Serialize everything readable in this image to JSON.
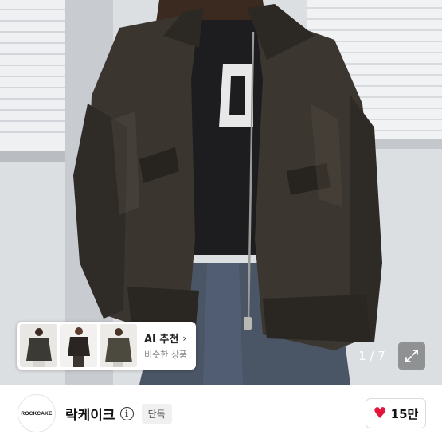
{
  "hero": {
    "image_description_icon": "product-photo"
  },
  "ai_card": {
    "title": "AI 추천",
    "chevron": "›",
    "subtitle": "비슷한 상품",
    "thumbnails": [
      "jacket-thumb-1",
      "jacket-thumb-2",
      "jacket-thumb-3"
    ]
  },
  "gallery": {
    "counter": "1 / 7",
    "expand_icon": "expand-icon"
  },
  "seller": {
    "avatar_text": "ROCKCAKE",
    "name": "락케이크",
    "info_icon": "i",
    "badge": "단독"
  },
  "like": {
    "heart": "♥",
    "count": "15만",
    "heart_color": "#e5143a"
  }
}
